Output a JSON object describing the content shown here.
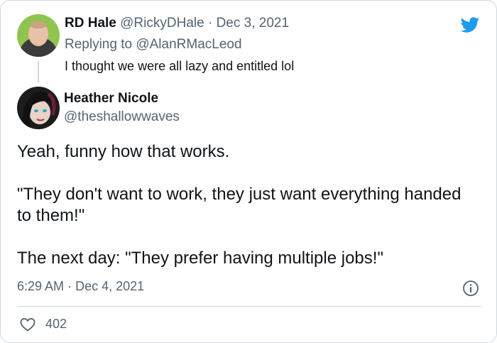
{
  "reply_tweet": {
    "author_name": "RD Hale",
    "author_handle": "@RickyDHale",
    "separator": "·",
    "date": "Dec 3, 2021",
    "replying_prefix": "Replying to",
    "replying_to": "@AlanRMacLeod",
    "text": "I thought we were all lazy and entitled lol"
  },
  "main_tweet": {
    "author_name": "Heather Nicole",
    "author_handle": "@theshallowwaves",
    "paragraphs": [
      "Yeah, funny how that works.",
      "\"They don't want to work, they just want everything handed to them!\"",
      "The next day: \"They prefer having multiple jobs!\""
    ],
    "time": "6:29 AM",
    "separator": "·",
    "date": "Dec 4, 2021",
    "like_count": "402"
  },
  "icons": {
    "brand": "twitter-bird-icon",
    "info": "info-icon",
    "like": "heart-icon"
  },
  "colors": {
    "brand_blue": "#1d9bf0",
    "text_primary": "#0f1419",
    "text_secondary": "#536471",
    "border": "#cfd9de"
  }
}
